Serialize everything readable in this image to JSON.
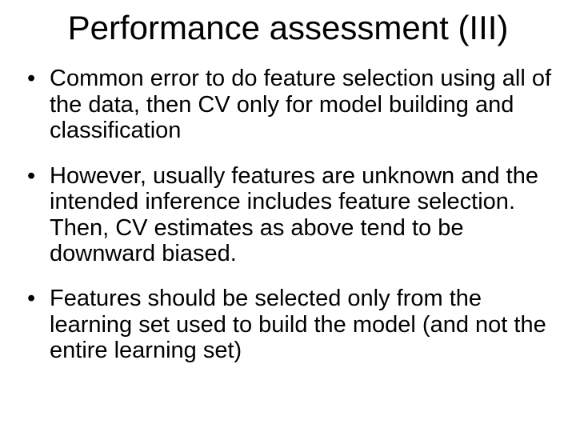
{
  "title": "Performance assessment (III)",
  "bullets": [
    {
      "text": "Common error to do feature selection using all of the data, then CV only for model building and classification",
      "bold": false
    },
    {
      "text": "However, usually features are unknown and the intended inference includes feature selection.  Then, CV estimates as above tend to be downward biased.",
      "bold": false
    },
    {
      "text": "Features  should be selected only from the learning set used to build the model (and not the entire learning set)",
      "bold": true
    }
  ]
}
